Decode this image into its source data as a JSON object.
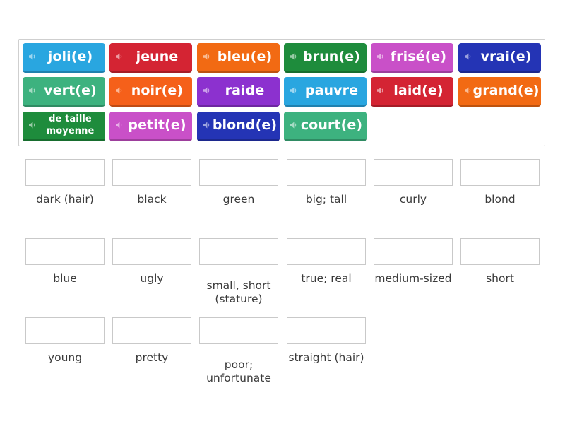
{
  "tiles": [
    {
      "label": "joli(e)",
      "color": "#29a6e0"
    },
    {
      "label": "jeune",
      "color": "#d42433"
    },
    {
      "label": "bleu(e)",
      "color": "#f26a13"
    },
    {
      "label": "brun(e)",
      "color": "#1e8c3c"
    },
    {
      "label": "frisé(e)",
      "color": "#c950c8"
    },
    {
      "label": "vrai(e)",
      "color": "#2434b5"
    },
    {
      "label": "vert(e)",
      "color": "#3db27f"
    },
    {
      "label": "noir(e)",
      "color": "#f5601a"
    },
    {
      "label": "raide",
      "color": "#8c31cf"
    },
    {
      "label": "pauvre",
      "color": "#29a6e0"
    },
    {
      "label": "laid(e)",
      "color": "#d42433"
    },
    {
      "label": "grand(e)",
      "color": "#f26a13"
    },
    {
      "label": "de taille moyenne",
      "color": "#1e8c3c"
    },
    {
      "label": "petit(e)",
      "color": "#c950c8"
    },
    {
      "label": "blond(e)",
      "color": "#2434b5"
    },
    {
      "label": "court(e)",
      "color": "#3db27f"
    }
  ],
  "clues": [
    "dark (hair)",
    "black",
    "green",
    "big; tall",
    "curly",
    "blond",
    "blue",
    "ugly",
    "small, short (stature)",
    "true; real",
    "medium-sized",
    "short",
    "young",
    "pretty",
    "poor; unfortunate",
    "straight (hair)"
  ],
  "icons": {
    "tile_audio": "speaker-icon"
  }
}
